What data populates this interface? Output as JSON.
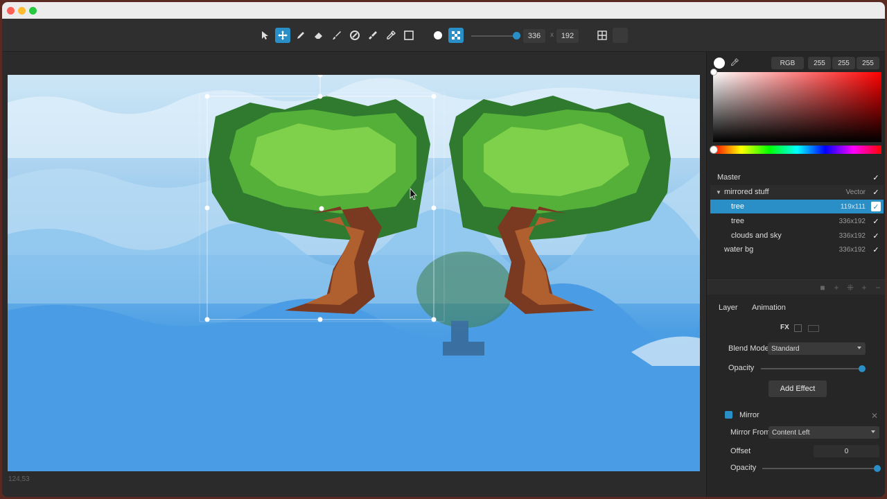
{
  "toolbar": {
    "tools": [
      {
        "icon": "arrow-pointer-icon",
        "active": false
      },
      {
        "icon": "move-icon",
        "active": true
      },
      {
        "icon": "pencil-icon",
        "active": false
      },
      {
        "icon": "eraser-icon",
        "active": false
      },
      {
        "icon": "brush-icon",
        "active": false
      },
      {
        "icon": "fill-bucket-icon",
        "active": false
      },
      {
        "icon": "smudge-icon",
        "active": false
      },
      {
        "icon": "eyedropper-icon",
        "active": false
      },
      {
        "icon": "rectangle-select-icon",
        "active": false
      },
      {
        "icon": "circle-brush-icon",
        "active": false
      },
      {
        "icon": "dither-brush-icon",
        "active": true
      }
    ],
    "width_value": "336",
    "size_separator": "x",
    "height_value": "192",
    "grid_icon": "grid-icon"
  },
  "canvas": {
    "coordinates": "124,53"
  },
  "color": {
    "mode": "RGB",
    "r": "255",
    "g": "255",
    "b": "255",
    "primary": "#ffffff",
    "accent": "#2a8fc7"
  },
  "layers": [
    {
      "name": "Master",
      "size": "",
      "selected": false,
      "indent": 0,
      "group": false
    },
    {
      "name": "mirrored stuff",
      "size": "Vector",
      "selected": false,
      "indent": 1,
      "group": true
    },
    {
      "name": "tree",
      "size": "119x111",
      "selected": true,
      "indent": 2,
      "group": false
    },
    {
      "name": "tree",
      "size": "336x192",
      "selected": false,
      "indent": 2,
      "group": false
    },
    {
      "name": "clouds and sky",
      "size": "336x192",
      "selected": false,
      "indent": 2,
      "group": false
    },
    {
      "name": "water bg",
      "size": "336x192",
      "selected": false,
      "indent": 1,
      "group": false
    }
  ],
  "panel_tabs": {
    "layer": "Layer",
    "animation": "Animation"
  },
  "layer_props": {
    "fx_label": "FX",
    "blend_mode_label": "Blend Mode",
    "blend_mode_value": "Standard",
    "opacity_label": "Opacity",
    "opacity_value": 1.0,
    "add_effect_label": "Add Effect"
  },
  "effect": {
    "name": "Mirror",
    "mirror_from_label": "Mirror From",
    "mirror_from_value": "Content Left",
    "offset_label": "Offset",
    "offset_value": "0",
    "opacity_label": "Opacity",
    "opacity_value": 1.0
  }
}
